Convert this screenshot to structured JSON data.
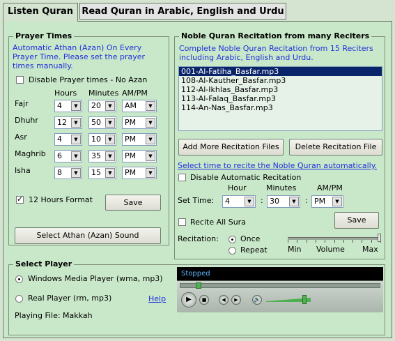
{
  "tabs": [
    {
      "label": "Listen Quran",
      "active": true
    },
    {
      "label": "Read Quran in Arabic, English and Urdu",
      "active": false
    }
  ],
  "prayer": {
    "title": "Prayer Times",
    "desc_line1": "Automatic Athan (Azan) On Every",
    "desc_line2": "Prayer Time. Please set the prayer",
    "desc_line3": "times manually.",
    "disable_label": "Disable Prayer times - No Azan",
    "disable_checked": false,
    "col_hours": "Hours",
    "col_minutes": "Minutes",
    "col_ampm": "AM/PM",
    "rows": [
      {
        "name": "Fajr",
        "hour": "4",
        "minute": "20",
        "ampm": "AM"
      },
      {
        "name": "Dhuhr",
        "hour": "12",
        "minute": "50",
        "ampm": "PM"
      },
      {
        "name": "Asr",
        "hour": "4",
        "minute": "10",
        "ampm": "PM"
      },
      {
        "name": "Maghrib",
        "hour": "6",
        "minute": "35",
        "ampm": "PM"
      },
      {
        "name": "Isha",
        "hour": "8",
        "minute": "15",
        "ampm": "PM"
      }
    ],
    "format_label": "12 Hours Format",
    "format_checked": true,
    "save_label": "Save",
    "athan_button": "Select Athan (Azan) Sound"
  },
  "recitation": {
    "title": "Noble Quran Recitation from many Reciters",
    "desc_line1": "Complete Noble Quran Recitation from 15 Reciters",
    "desc_line2": "including Arabic, English and Urdu.",
    "files": [
      "001-Al-Fatiha_Basfar.mp3",
      "108-Al-Kauther_Basfar.mp3",
      "112-Al-Ikhlas_Basfar.mp3",
      "113-Al-Falaq_Basfar.mp3",
      "114-An-Nas_Basfar.mp3"
    ],
    "selected_index": 0,
    "add_button": "Add More Recitation Files",
    "delete_button": "Delete Recitation File",
    "schedule_link": "Select time to recite the Noble Quran automatically.",
    "disable_label": "Disable Automatic Recitation",
    "col_hour": "Hour",
    "col_minutes": "Minutes",
    "col_ampm": "AM/PM",
    "set_time_label": "Set Time:",
    "time_sep": ":",
    "hour": "4",
    "minute": "30",
    "ampm": "PM",
    "save_label": "Save",
    "all_sura_label": "Recite All Sura",
    "recitation_label": "Recitation:",
    "once_label": "Once",
    "repeat_label": "Repeat",
    "mode": "Once",
    "volume_min": "Min",
    "volume_label": "Volume",
    "volume_max": "Max",
    "volume_level": 1.0
  },
  "player": {
    "title": "Select Player",
    "wmp_label": "Windows Media Player (wma, mp3)",
    "real_label": "Real Player (rm, mp3)",
    "help_link": "Help",
    "selected": "wmp",
    "playing_label": "Playing File: Makkah",
    "status": "Stopped",
    "seek_position": 0.08,
    "volume_position": 0.9
  },
  "colors": {
    "panel_bg": "#c9e8c9",
    "link_blue": "#1f2fdc",
    "selection": "#0a246a",
    "player_bg": "#000000"
  }
}
